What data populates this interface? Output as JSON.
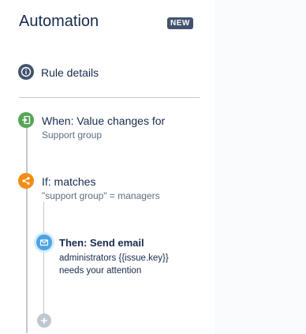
{
  "header": {
    "title": "Automation",
    "badge": "NEW"
  },
  "rule_details": {
    "label": "Rule details",
    "icon": "info-icon"
  },
  "trigger": {
    "label": "When: Value changes for",
    "sub": "Support group",
    "icon": "trigger-icon",
    "color": "#57a55a"
  },
  "condition": {
    "label": "If: matches",
    "sub": "\"support group\" = managers",
    "icon": "branch-icon",
    "color": "#f18d13"
  },
  "action": {
    "title": "Then: Send email",
    "body": "administrators {{issue.key}} needs your attention",
    "icon": "mail-icon",
    "color": "#4ba3e3"
  },
  "add_component": {
    "symbol": "+",
    "icon": "add-icon"
  }
}
